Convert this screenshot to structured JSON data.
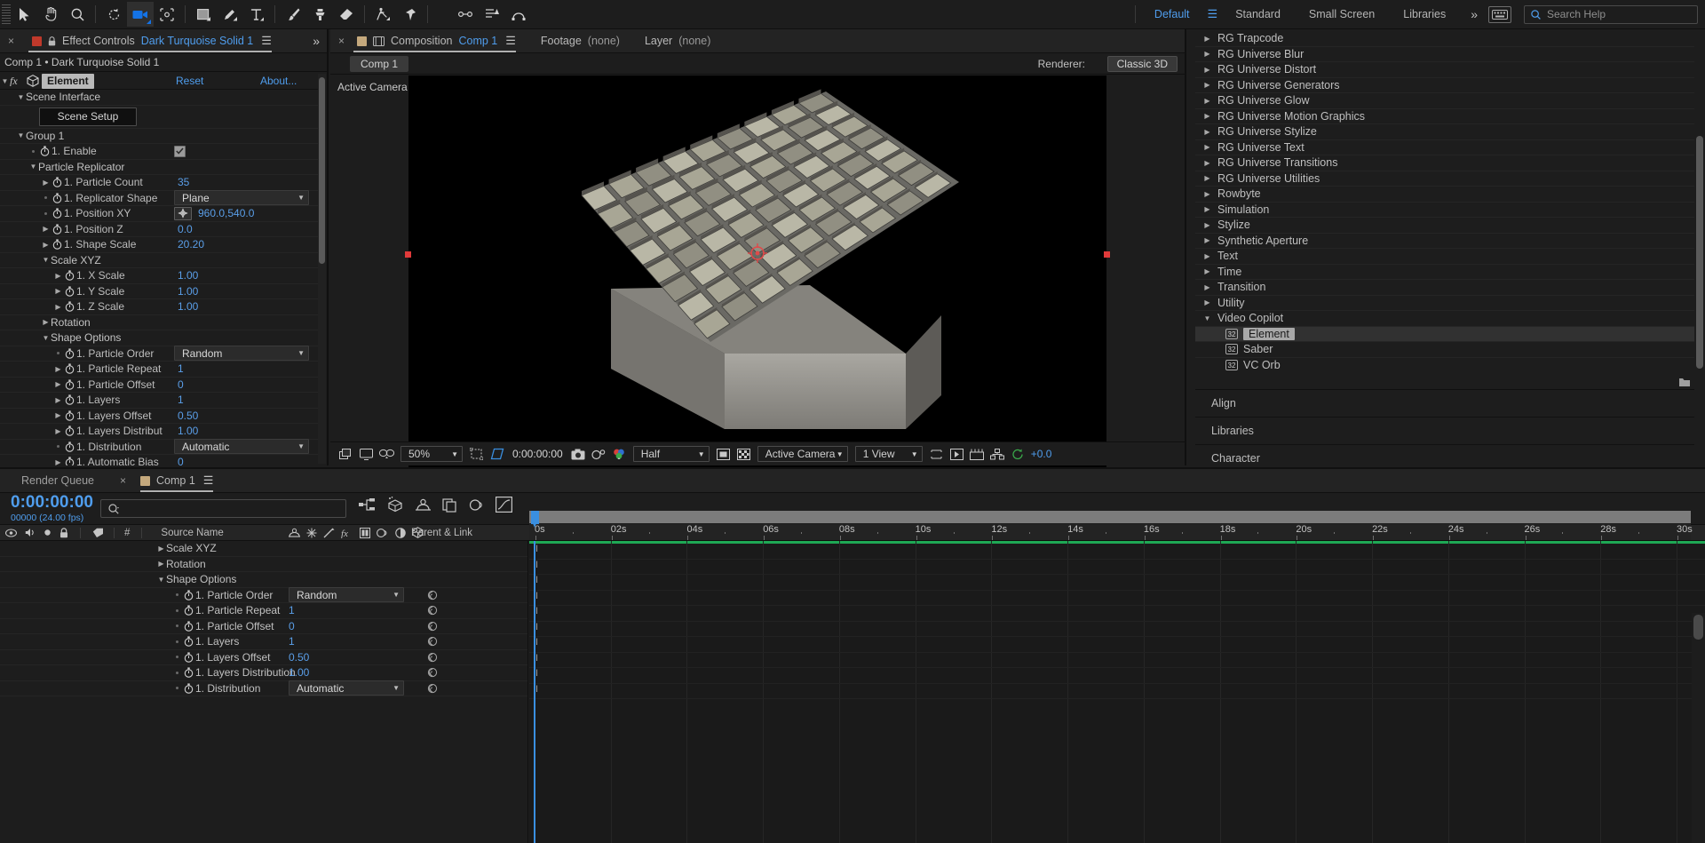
{
  "toolbar": {
    "tools": [
      {
        "name": "selection-tool",
        "icon": "arrow"
      },
      {
        "name": "hand-tool",
        "icon": "hand"
      },
      {
        "name": "zoom-tool",
        "icon": "magnifier"
      },
      {
        "name": "rotation-tool",
        "icon": "rotate"
      },
      {
        "name": "camera-tool",
        "icon": "camera",
        "active": true
      },
      {
        "name": "pan-behind-tool",
        "icon": "anchor"
      },
      {
        "name": "shape-tool",
        "icon": "square"
      },
      {
        "name": "pen-tool",
        "icon": "pen"
      },
      {
        "name": "type-tool",
        "icon": "type"
      },
      {
        "name": "brush-tool",
        "icon": "brush"
      },
      {
        "name": "clone-stamp-tool",
        "icon": "stamp"
      },
      {
        "name": "eraser-tool",
        "icon": "eraser"
      },
      {
        "name": "roto-brush-tool",
        "icon": "roto"
      },
      {
        "name": "puppet-pin-tool",
        "icon": "pin"
      },
      {
        "name": "align-tool",
        "icon": "align"
      },
      {
        "name": "text-align-tool",
        "icon": "textalign"
      },
      {
        "name": "mask-tool",
        "icon": "mask"
      }
    ],
    "workspaces": [
      {
        "label": "Default",
        "selected": true
      },
      {
        "label": "Standard",
        "selected": false
      },
      {
        "label": "Small Screen",
        "selected": false
      },
      {
        "label": "Libraries",
        "selected": false
      }
    ],
    "overflow_label": "»",
    "search_placeholder": "Search Help"
  },
  "effect_controls": {
    "tab_label": "Effect Controls",
    "tab_layer": "Dark Turquoise Solid 1",
    "subtitle": "Comp 1 • Dark Turquoise Solid 1",
    "effect_name": "Element",
    "reset_label": "Reset",
    "about_label": "About...",
    "scene_setup_label": "Scene Setup",
    "rows": [
      {
        "indent": 1,
        "tri": "down",
        "label": "Scene Interface",
        "type": "group"
      },
      {
        "indent": 3,
        "label": "",
        "type": "button"
      },
      {
        "indent": 1,
        "tri": "down",
        "label": "Group 1",
        "type": "group"
      },
      {
        "indent": 2,
        "dot": true,
        "stopwatch": true,
        "label": "1. Enable",
        "type": "checkbox",
        "value": "checked"
      },
      {
        "indent": 2,
        "tri": "down",
        "label": "Particle Replicator",
        "type": "group"
      },
      {
        "indent": 3,
        "tri": "right",
        "stopwatch": true,
        "label": "1. Particle Count",
        "type": "number",
        "value": "35"
      },
      {
        "indent": 3,
        "dot": true,
        "stopwatch": true,
        "label": "1. Replicator Shape",
        "type": "dropdown",
        "value": "Plane"
      },
      {
        "indent": 3,
        "dot": true,
        "stopwatch": true,
        "label": "1. Position XY",
        "type": "point",
        "value": "960.0,540.0"
      },
      {
        "indent": 3,
        "tri": "right",
        "stopwatch": true,
        "label": "1. Position Z",
        "type": "number",
        "value": "0.0"
      },
      {
        "indent": 3,
        "tri": "right",
        "stopwatch": true,
        "label": "1. Shape Scale",
        "type": "number",
        "value": "20.20"
      },
      {
        "indent": 3,
        "tri": "down",
        "label": "Scale XYZ",
        "type": "group"
      },
      {
        "indent": 4,
        "tri": "right",
        "stopwatch": true,
        "label": "1. X Scale",
        "type": "number",
        "value": "1.00"
      },
      {
        "indent": 4,
        "tri": "right",
        "stopwatch": true,
        "label": "1. Y Scale",
        "type": "number",
        "value": "1.00"
      },
      {
        "indent": 4,
        "tri": "right",
        "stopwatch": true,
        "label": "1. Z Scale",
        "type": "number",
        "value": "1.00"
      },
      {
        "indent": 3,
        "tri": "right",
        "label": "Rotation",
        "type": "group"
      },
      {
        "indent": 3,
        "tri": "down",
        "label": "Shape Options",
        "type": "group"
      },
      {
        "indent": 4,
        "dot": true,
        "stopwatch": true,
        "label": "1. Particle Order",
        "type": "dropdown",
        "value": "Random"
      },
      {
        "indent": 4,
        "tri": "right",
        "stopwatch": true,
        "label": "1. Particle Repeat",
        "type": "number",
        "value": "1"
      },
      {
        "indent": 4,
        "tri": "right",
        "stopwatch": true,
        "label": "1. Particle Offset",
        "type": "number",
        "value": "0"
      },
      {
        "indent": 4,
        "tri": "right",
        "stopwatch": true,
        "label": "1. Layers",
        "type": "number",
        "value": "1"
      },
      {
        "indent": 4,
        "tri": "right",
        "stopwatch": true,
        "label": "1. Layers Offset",
        "type": "number",
        "value": "0.50"
      },
      {
        "indent": 4,
        "tri": "right",
        "stopwatch": true,
        "label": "1. Layers Distribut",
        "type": "number",
        "value": "1.00"
      },
      {
        "indent": 4,
        "dot": true,
        "stopwatch": true,
        "label": "1. Distribution",
        "type": "dropdown-wide",
        "value": "Automatic"
      },
      {
        "indent": 4,
        "tri": "right",
        "stopwatch": true,
        "label": "1. Automatic Bias",
        "type": "number",
        "value": "0"
      }
    ]
  },
  "composition": {
    "tabs": [
      {
        "label": "Composition",
        "value": "Comp 1",
        "active": true
      },
      {
        "label": "Footage",
        "value": "(none)",
        "active": false
      },
      {
        "label": "Layer",
        "value": "(none)",
        "active": false
      }
    ],
    "comp_pill": "Comp 1",
    "renderer_label": "Renderer:",
    "renderer_value": "Classic 3D",
    "active_camera_label": "Active Camera",
    "bottom_bar": {
      "magnification": "50%",
      "timecode": "0:00:00:00",
      "resolution": "Half",
      "view_layout": "Active Camera",
      "views": "1 View",
      "exposure": "+0.0"
    }
  },
  "effects_panel": {
    "items": [
      {
        "label": "RG Trapcode",
        "type": "folder"
      },
      {
        "label": "RG Universe Blur",
        "type": "folder"
      },
      {
        "label": "RG Universe Distort",
        "type": "folder"
      },
      {
        "label": "RG Universe Generators",
        "type": "folder"
      },
      {
        "label": "RG Universe Glow",
        "type": "folder"
      },
      {
        "label": "RG Universe Motion Graphics",
        "type": "folder"
      },
      {
        "label": "RG Universe Stylize",
        "type": "folder"
      },
      {
        "label": "RG Universe Text",
        "type": "folder"
      },
      {
        "label": "RG Universe Transitions",
        "type": "folder"
      },
      {
        "label": "RG Universe Utilities",
        "type": "folder"
      },
      {
        "label": "Rowbyte",
        "type": "folder"
      },
      {
        "label": "Simulation",
        "type": "folder"
      },
      {
        "label": "Stylize",
        "type": "folder"
      },
      {
        "label": "Synthetic Aperture",
        "type": "folder"
      },
      {
        "label": "Text",
        "type": "folder"
      },
      {
        "label": "Time",
        "type": "folder"
      },
      {
        "label": "Transition",
        "type": "folder"
      },
      {
        "label": "Utility",
        "type": "folder"
      },
      {
        "label": "Video Copilot",
        "type": "folder-open"
      },
      {
        "label": "Element",
        "type": "effect",
        "selected": true,
        "badge": "32"
      },
      {
        "label": "Saber",
        "type": "effect",
        "badge": "32"
      },
      {
        "label": "VC Orb",
        "type": "effect",
        "badge": "32"
      }
    ],
    "collapsed_panels": [
      {
        "label": "Align"
      },
      {
        "label": "Libraries"
      },
      {
        "label": "Character"
      }
    ]
  },
  "timeline": {
    "render_queue_label": "Render Queue",
    "comp_tab_label": "Comp 1",
    "current_time": "0:00:00:00",
    "frame_info": "00000 (24.00 fps)",
    "search_placeholder": "",
    "columns": {
      "number": "#",
      "source_name": "Source Name",
      "parent_link": "Parent & Link"
    },
    "ruler_ticks": [
      "0s",
      "02s",
      "04s",
      "06s",
      "08s",
      "10s",
      "12s",
      "14s",
      "16s",
      "18s",
      "20s",
      "22s",
      "24s",
      "26s",
      "28s",
      "30s"
    ],
    "rows": [
      {
        "indent": 2,
        "tri": "right",
        "label": "Scale XYZ",
        "type": "group"
      },
      {
        "indent": 2,
        "tri": "right",
        "label": "Rotation",
        "type": "group"
      },
      {
        "indent": 2,
        "tri": "down",
        "label": "Shape Options",
        "type": "group"
      },
      {
        "indent": 3,
        "dot": true,
        "stopwatch": true,
        "label": "1. Particle Order",
        "type": "dropdown",
        "value": "Random"
      },
      {
        "indent": 3,
        "dot": true,
        "stopwatch": true,
        "label": "1. Particle Repeat",
        "type": "number",
        "value": "1"
      },
      {
        "indent": 3,
        "dot": true,
        "stopwatch": true,
        "label": "1. Particle Offset",
        "type": "number",
        "value": "0"
      },
      {
        "indent": 3,
        "dot": true,
        "stopwatch": true,
        "label": "1. Layers",
        "type": "number",
        "value": "1"
      },
      {
        "indent": 3,
        "dot": true,
        "stopwatch": true,
        "label": "1. Layers Offset",
        "type": "number",
        "value": "0.50"
      },
      {
        "indent": 3,
        "dot": true,
        "stopwatch": true,
        "label": "1. Layers Distribution",
        "type": "number",
        "value": "1.00"
      },
      {
        "indent": 3,
        "dot": true,
        "stopwatch": true,
        "label": "1. Distribution",
        "type": "dropdown",
        "value": "Automatic"
      }
    ]
  },
  "colors": {
    "accent_blue": "#4f9ded",
    "value_blue": "#5a9ee8",
    "panel_bg": "#1d1d1d",
    "cti_blue": "#3a8fe0",
    "green_bar": "#1ea854",
    "red_handle": "#e03a3a"
  }
}
